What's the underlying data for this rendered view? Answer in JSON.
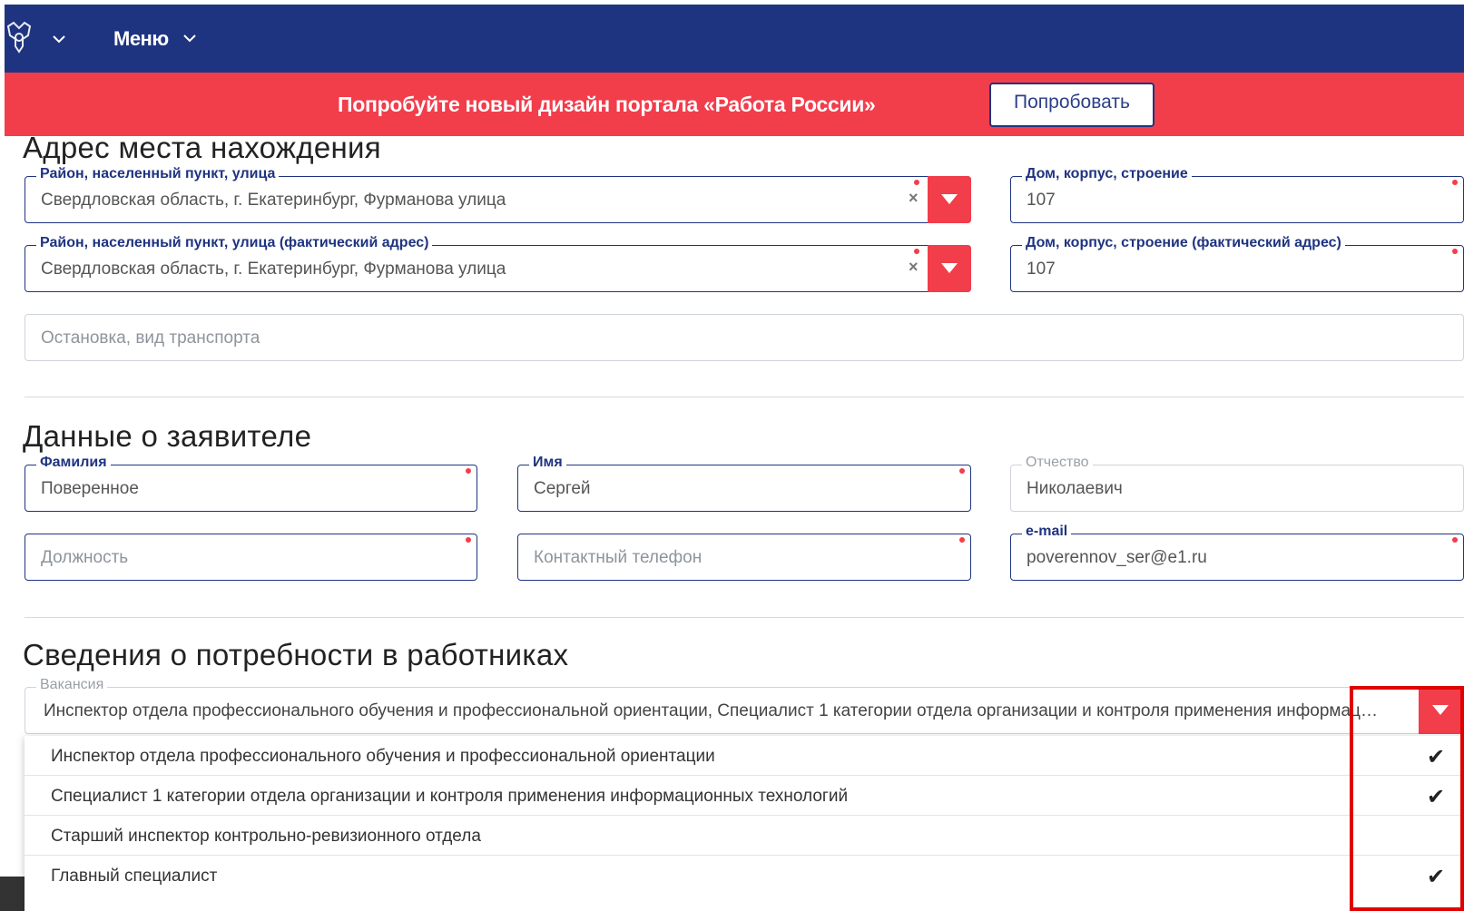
{
  "header": {
    "emblem_icon": "coat-of-arms-icon",
    "menu_label": "Меню"
  },
  "promo": {
    "text": "Попробуйте новый дизайн портала «Работа России»",
    "button_label": "Попробовать"
  },
  "address": {
    "title": "Адрес места нахождения",
    "street_label": "Район, населенный пункт, улица",
    "street_value": "Свердловская область, г. Екатеринбург, Фурманова улица",
    "house_label": "Дом, корпус, строение",
    "house_value": "107",
    "fact_street_label": "Район, населенный пункт, улица (фактический адрес)",
    "fact_street_value": "Свердловская область, г. Екатеринбург, Фурманова улица",
    "fact_house_label": "Дом, корпус, строение (фактический адрес)",
    "fact_house_value": "107",
    "transport_placeholder": "Остановка, вид транспорта",
    "clear_glyph": "×"
  },
  "applicant": {
    "title": "Данные о заявителе",
    "surname_label": "Фамилия",
    "surname_value": "Поверенное",
    "name_label": "Имя",
    "name_value": "Сергей",
    "patronymic_label": "Отчество",
    "patronymic_value": "Николаевич",
    "position_placeholder": "Должность",
    "phone_placeholder": "Контактный телефон",
    "email_label": "e-mail",
    "email_value": "poverennov_ser@e1.ru"
  },
  "needs": {
    "title": "Сведения о потребности в работниках",
    "vacancy_label": "Вакансия",
    "vacancy_value": "Инспектор отдела профессионального обучения и профессиональной ориентации, Специалист 1 категории отдела организации и контроля применения информационных технологий",
    "options": [
      {
        "label": "Инспектор отдела профессионального обучения и профессиональной ориентации",
        "checked": true,
        "check": "✔"
      },
      {
        "label": "Специалист 1 категории отдела организации и контроля применения информационных технологий",
        "checked": true,
        "check": "✔"
      },
      {
        "label": "Старший инспектор контрольно-ревизионного отдела",
        "checked": false,
        "check": ""
      },
      {
        "label": "Главный специалист",
        "checked": true,
        "check": "✔"
      }
    ]
  },
  "colors": {
    "header_blue": "#1f3480",
    "accent_red": "#f23d4b",
    "highlight_red": "#e10000"
  }
}
